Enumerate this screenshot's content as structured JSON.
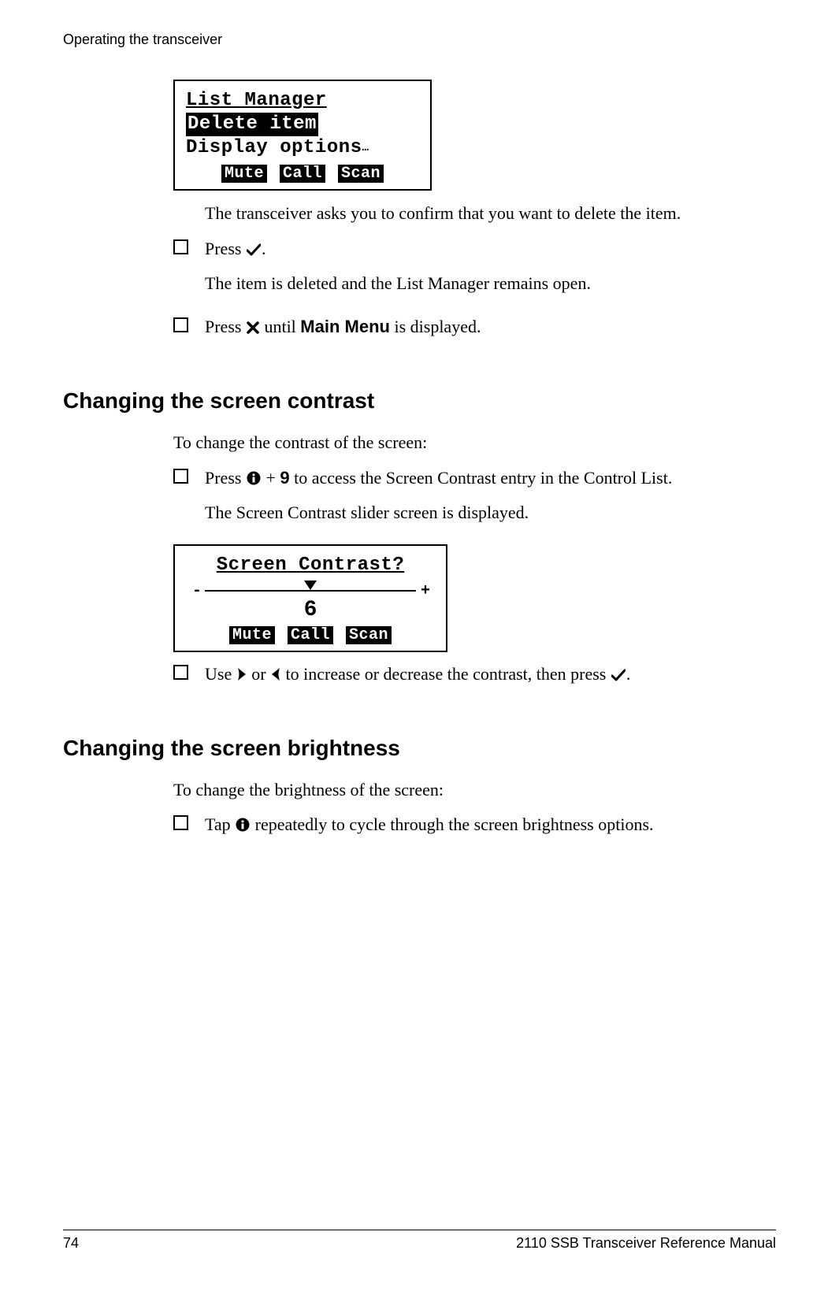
{
  "header": {
    "running": "Operating the transceiver"
  },
  "lcd1": {
    "title": "List Manager",
    "row_selected": "Delete item",
    "row2": "Display options",
    "ellipsis": "…",
    "soft": {
      "mute": "Mute",
      "call": "Call",
      "scan": "Scan"
    }
  },
  "after_lcd1_para": "The transceiver asks you to confirm that you want to delete the item.",
  "step_press_check": {
    "line1_a": "Press ",
    "line1_b": ".",
    "para": "The item is deleted and the List Manager remains open."
  },
  "step_press_x": {
    "a": "Press ",
    "b": " until ",
    "main_menu": "Main Menu",
    "c": " is displayed."
  },
  "contrast": {
    "heading": "Changing the screen contrast",
    "intro": "To change the contrast of the screen:",
    "step1_a": "Press ",
    "step1_plus": " + ",
    "step1_nine": "9",
    "step1_b": " to access the Screen Contrast entry in the Control List.",
    "step1_para": "The Screen Contrast slider screen is displayed.",
    "lcd": {
      "title": "Screen Contrast?",
      "value": "6",
      "soft": {
        "mute": "Mute",
        "call": "Call",
        "scan": "Scan"
      }
    },
    "step2_a": "Use ",
    "step2_or": " or ",
    "step2_b": " to increase or decrease the contrast, then press ",
    "step2_c": "."
  },
  "brightness": {
    "heading": "Changing the screen brightness",
    "intro": "To change the brightness of the screen:",
    "step_a": "Tap ",
    "step_b": " repeatedly to cycle through the screen brightness options."
  },
  "footer": {
    "page": "74",
    "title": "2110 SSB Transceiver Reference Manual"
  }
}
